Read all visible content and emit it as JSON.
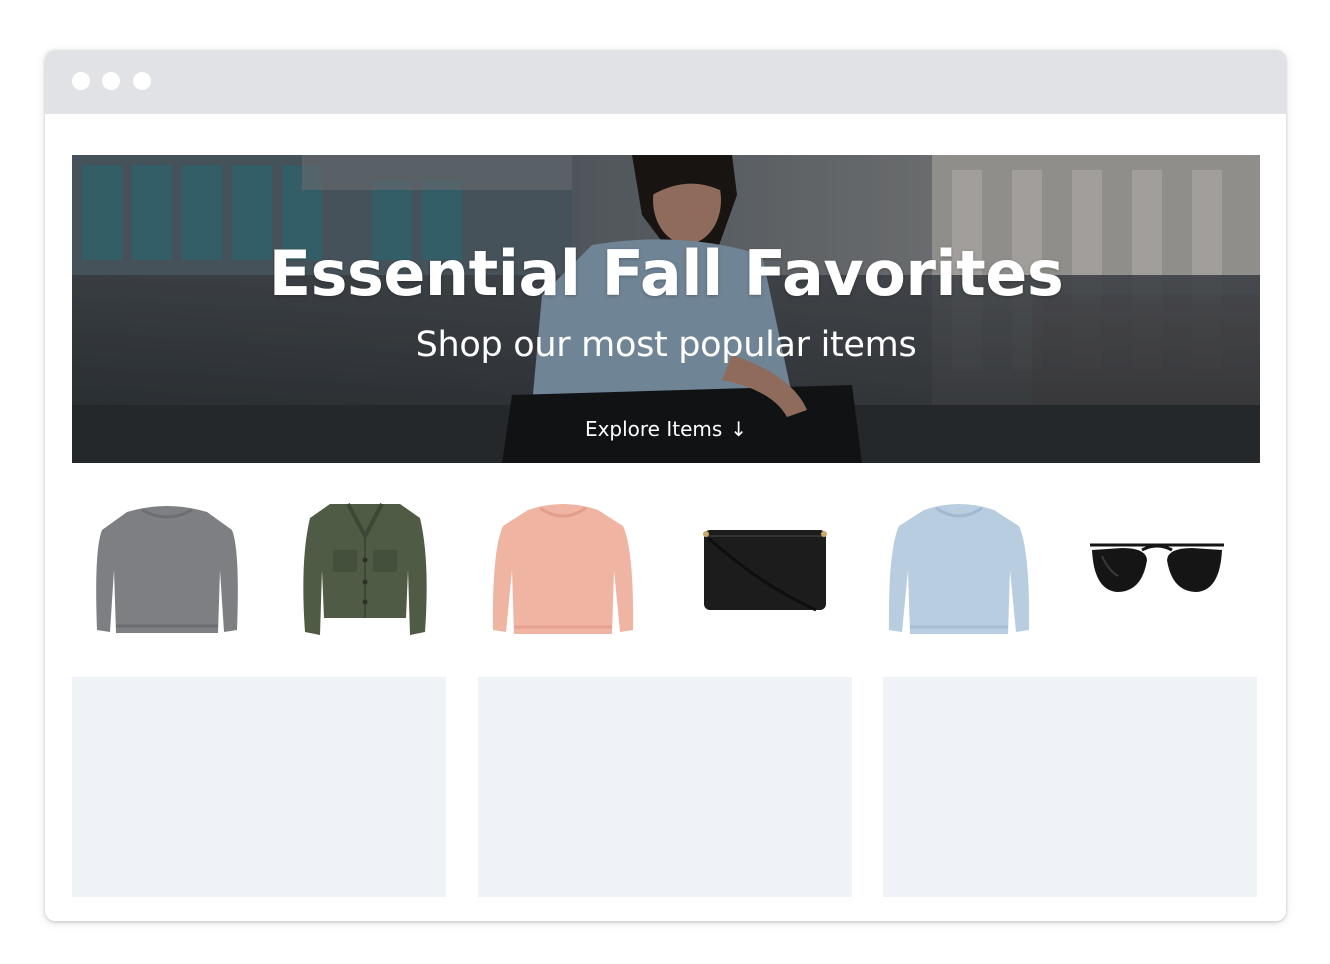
{
  "hero": {
    "title": "Essential Fall Favorites",
    "subtitle": "Shop our most popular items",
    "cta_label": "Explore Items",
    "cta_arrow": "↓"
  },
  "products": [
    {
      "icon": "gray-sweater-icon",
      "color": "#7d7f83"
    },
    {
      "icon": "green-jacket-icon",
      "color": "#4f5b44"
    },
    {
      "icon": "pink-sweater-icon",
      "color": "#f0b4a3"
    },
    {
      "icon": "black-handbag-icon",
      "color": "#1c1c1c"
    },
    {
      "icon": "blue-sweater-icon",
      "color": "#b8cde0"
    },
    {
      "icon": "sunglasses-icon",
      "color": "#151515"
    }
  ],
  "colors": {
    "titlebar": "#e1e2e6",
    "card_placeholder": "#eff2f6"
  }
}
